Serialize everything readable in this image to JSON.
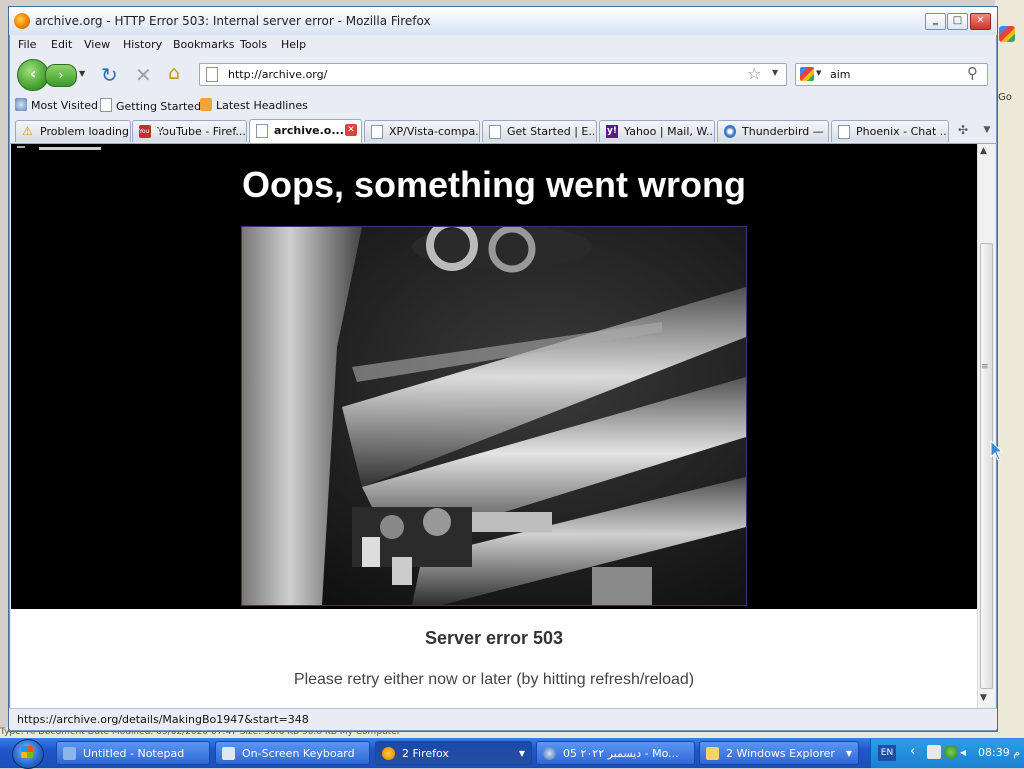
{
  "background": {
    "go_label": "Go",
    "status_strip": "Type: Ai Document  Date Modified: 09/02/2020 07:47  Size: 36.6 KB                                                             56.6 KB                      My Computer"
  },
  "window": {
    "title": "archive.org - HTTP Error 503: Internal server error - Mozilla Firefox",
    "buttons": {
      "minimize": "‗",
      "maximize": "□",
      "close": "✕"
    }
  },
  "menu": [
    "File",
    "Edit",
    "View",
    "History",
    "Bookmarks",
    "Tools",
    "Help"
  ],
  "navigation": {
    "back_glyph": "‹",
    "forward_glyph": "›",
    "url": "http://archive.org/",
    "search_value": "aim"
  },
  "bookmarks": [
    "Most Visited",
    "Getting Started",
    "Latest Headlines"
  ],
  "tabs": [
    {
      "label": "Problem loading...",
      "icon": "warning-icon",
      "active": false
    },
    {
      "label": "YouTube - Firef...",
      "icon": "youtube-icon",
      "active": false
    },
    {
      "label": "archive.o...",
      "icon": "page-icon",
      "active": true
    },
    {
      "label": "XP/Vista-compa...",
      "icon": "page-icon",
      "active": false
    },
    {
      "label": "Get Started | E...",
      "icon": "page-icon",
      "active": false
    },
    {
      "label": "Yahoo | Mail, W...",
      "icon": "yahoo-icon",
      "active": false
    },
    {
      "label": "Thunderbird — ...",
      "icon": "thunderbird-icon",
      "active": false
    },
    {
      "label": "Phoenix - Chat ...",
      "icon": "page-icon",
      "active": false
    }
  ],
  "youtube_icon_text": "You Tube",
  "yahoo_icon_text": "y!",
  "page": {
    "heading": "Oops, something went wrong",
    "error_title": "Server error 503",
    "error_message": "Please retry either now or later (by hitting refresh/reload)"
  },
  "status": "https://archive.org/details/MakingBo1947&start=348",
  "taskbar": {
    "tasks": [
      {
        "label": "Untitled - Notepad",
        "active": false
      },
      {
        "label": "On-Screen Keyboard",
        "active": false
      },
      {
        "label": "2 Firefox",
        "active": true
      },
      {
        "label": "05 ۲۰۲۲ دیسمبر - Mo...",
        "active": false
      },
      {
        "label": "2 Windows Explorer",
        "active": false
      }
    ],
    "lang": "EN",
    "clock": "08:39 م"
  },
  "colors": {
    "page_black": "#000000",
    "photo_border": "#4b2a7a",
    "taskbar": "#1f56c8"
  }
}
